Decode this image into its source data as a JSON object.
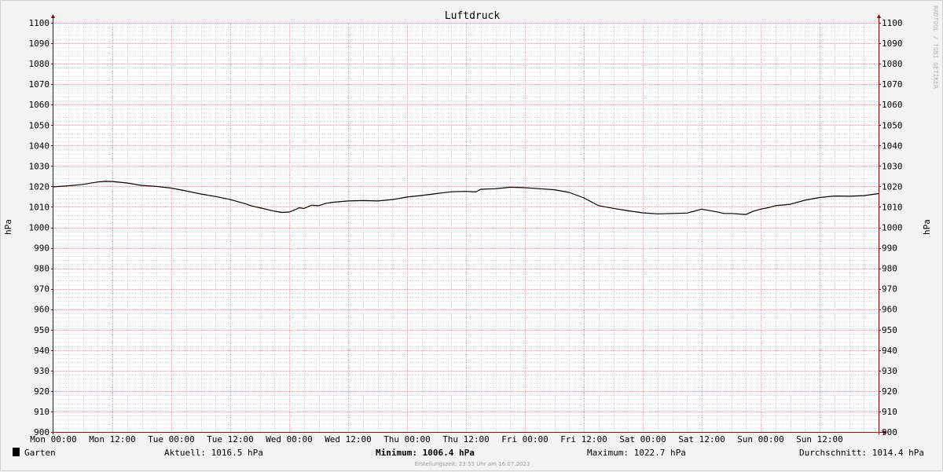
{
  "chart_data": {
    "type": "line",
    "title": "Luftdruck",
    "ylabel": "hPa",
    "ylim": [
      900,
      1100
    ],
    "yticks": [
      900,
      910,
      920,
      930,
      940,
      950,
      960,
      970,
      980,
      990,
      1000,
      1010,
      1020,
      1030,
      1040,
      1050,
      1060,
      1070,
      1080,
      1090,
      1100
    ],
    "xlim": [
      0,
      168
    ],
    "xtick_labels": [
      "Mon 00:00",
      "Mon 12:00",
      "Tue 00:00",
      "Tue 12:00",
      "Wed 00:00",
      "Wed 12:00",
      "Thu 00:00",
      "Thu 12:00",
      "Fri 00:00",
      "Fri 12:00",
      "Sat 00:00",
      "Sat 12:00",
      "Sun 00:00",
      "Sun 12:00"
    ],
    "grid": true,
    "series": [
      {
        "name": "Garten",
        "color": "#000000",
        "x": [
          0,
          3,
          6,
          9,
          10.5,
          12,
          15,
          18,
          21,
          24,
          27,
          30,
          33,
          36,
          39,
          40.5,
          42,
          45,
          46.5,
          48,
          49,
          50,
          51,
          52.5,
          54,
          55.5,
          57,
          60,
          63,
          66,
          69,
          72,
          75,
          78,
          81,
          84,
          86,
          87,
          90,
          93,
          96,
          99,
          102,
          105,
          108,
          111,
          114,
          117,
          120,
          123,
          126,
          129,
          132,
          135,
          136.5,
          138,
          141,
          142.5,
          144,
          145.5,
          147,
          150,
          153,
          156,
          159,
          162,
          165,
          168
        ],
        "values": [
          1019.8,
          1020.3,
          1021,
          1022.2,
          1022.5,
          1022.4,
          1021.7,
          1020.5,
          1020.0,
          1019.2,
          1017.8,
          1016.3,
          1015.1,
          1013.6,
          1011.6,
          1010.4,
          1009.6,
          1007.9,
          1007.3,
          1007.5,
          1008.4,
          1009.6,
          1009.2,
          1010.8,
          1010.6,
          1011.8,
          1012.3,
          1012.9,
          1013.1,
          1012.9,
          1013.6,
          1014.8,
          1015.6,
          1016.5,
          1017.4,
          1017.6,
          1017.3,
          1018.6,
          1018.9,
          1019.6,
          1019.4,
          1018.9,
          1018.4,
          1017.1,
          1014.4,
          1010.6,
          1009.3,
          1008.1,
          1007.1,
          1006.6,
          1006.8,
          1007.0,
          1008.9,
          1007.6,
          1006.8,
          1006.8,
          1006.3,
          1007.9,
          1008.9,
          1009.6,
          1010.6,
          1011.3,
          1013.3,
          1014.6,
          1015.3,
          1015.2,
          1015.5,
          1016.5
        ]
      }
    ]
  },
  "sidebar_text": "RRDTOOL / TOBI OETIKER",
  "legend": {
    "series_label": "Garten",
    "aktuell": "Aktuell: 1016.5 hPa",
    "minimum": "Minimum: 1006.4 hPa",
    "maximum": "Maximum: 1022.7 hPa",
    "durchschnitt": "Durchschnitt: 1014.4 hPa"
  },
  "footer": "Erstellungszeit: 23:55 Uhr am 16.07.2023",
  "colors": {
    "background": "#f3f3f3",
    "plot_background": "#ffffff",
    "major_grid": "#f0a0a0",
    "minor_grid": "#d8d8d8",
    "axis": "#8a0000",
    "line": "#000000"
  }
}
